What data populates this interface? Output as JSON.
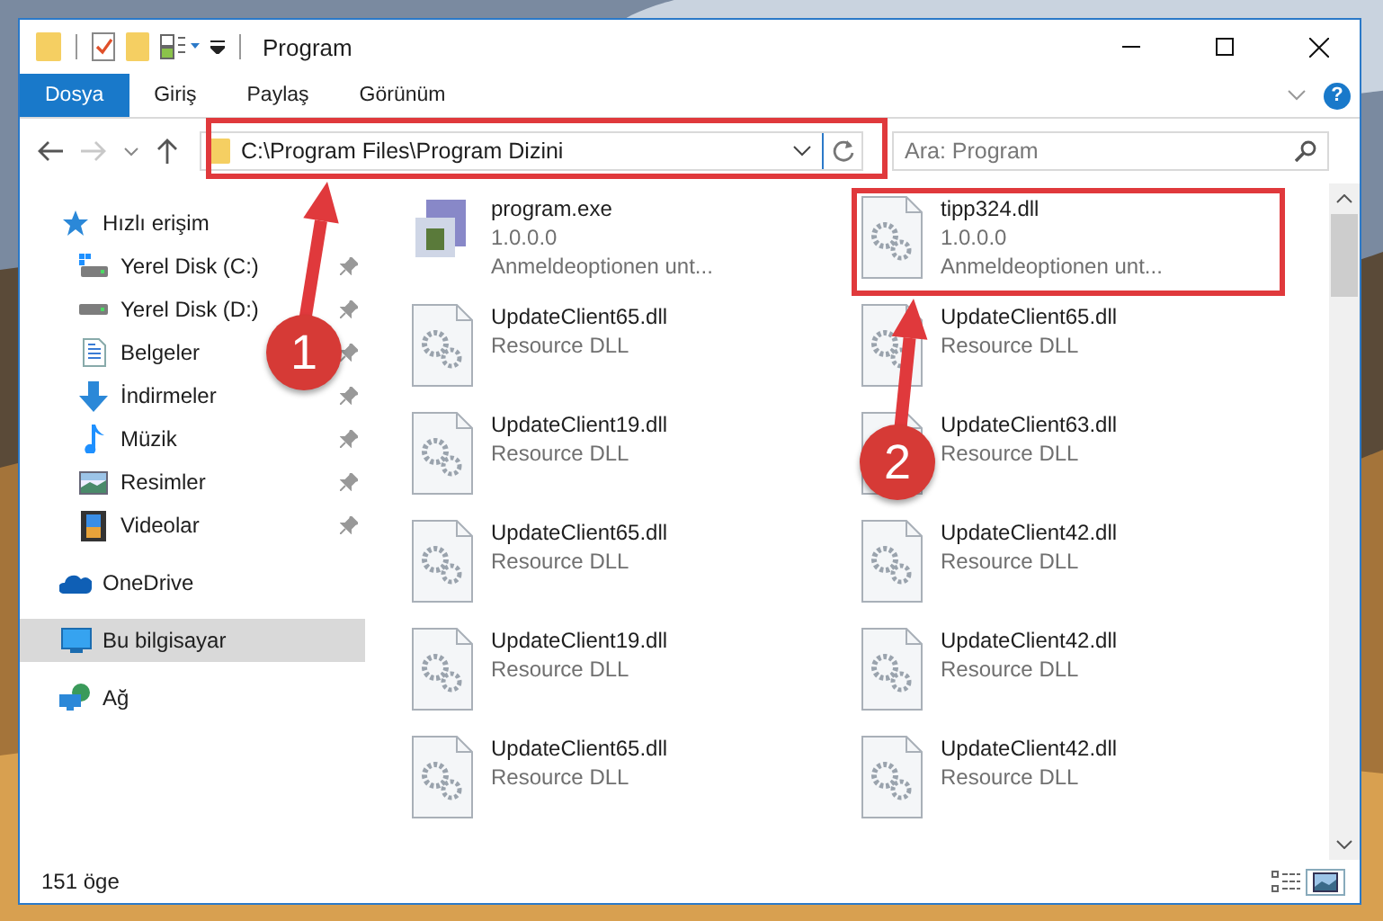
{
  "window": {
    "title": "Program"
  },
  "ribbon": {
    "tabs": [
      {
        "label": "Dosya",
        "selected": true
      },
      {
        "label": "Giriş",
        "selected": false
      },
      {
        "label": "Paylaş",
        "selected": false
      },
      {
        "label": "Görünüm",
        "selected": false
      }
    ],
    "help": "?"
  },
  "address": {
    "path": "C:\\Program Files\\Program Dizini",
    "search_placeholder": "Ara: Program"
  },
  "sidebar": {
    "items": [
      {
        "label": "Hızlı erişim",
        "kind": "star",
        "selected": false,
        "children": [
          {
            "label": "Yerel Disk (C:)",
            "kind": "system-drive",
            "selected": false,
            "pinned": true
          },
          {
            "label": "Yerel Disk (D:)",
            "kind": "drive",
            "selected": false,
            "pinned": true
          },
          {
            "label": "Belgeler",
            "kind": "documents",
            "selected": false,
            "pinned": true
          },
          {
            "label": "İndirmeler",
            "kind": "download",
            "selected": false,
            "pinned": true
          },
          {
            "label": "Müzik",
            "kind": "music",
            "selected": false,
            "pinned": true
          },
          {
            "label": "Resimler",
            "kind": "pictures",
            "selected": false,
            "pinned": true
          },
          {
            "label": "Videolar",
            "kind": "videos",
            "selected": false,
            "pinned": true
          }
        ]
      },
      {
        "label": "OneDrive",
        "kind": "cloud",
        "selected": false
      },
      {
        "label": "Bu bilgisayar",
        "kind": "computer",
        "selected": true
      },
      {
        "label": "Ağ",
        "kind": "network",
        "selected": false
      }
    ]
  },
  "files": [
    {
      "name": "program.exe",
      "lines": [
        "1.0.0.0",
        "Anmeldeoptionen unt..."
      ],
      "kind": "exe"
    },
    {
      "name": "tipp324.dll",
      "lines": [
        "1.0.0.0",
        "Anmeldeoptionen unt..."
      ],
      "kind": "dll"
    },
    {
      "name": "UpdateClient65.dll",
      "lines": [
        "Resource DLL"
      ],
      "kind": "dll"
    },
    {
      "name": "UpdateClient65.dll",
      "lines": [
        "Resource DLL"
      ],
      "kind": "dll"
    },
    {
      "name": "UpdateClient19.dll",
      "lines": [
        "Resource DLL"
      ],
      "kind": "dll"
    },
    {
      "name": "UpdateClient63.dll",
      "lines": [
        "Resource DLL"
      ],
      "kind": "dll"
    },
    {
      "name": "UpdateClient65.dll",
      "lines": [
        "Resource DLL"
      ],
      "kind": "dll"
    },
    {
      "name": "UpdateClient42.dll",
      "lines": [
        "Resource DLL"
      ],
      "kind": "dll"
    },
    {
      "name": "UpdateClient19.dll",
      "lines": [
        "Resource DLL"
      ],
      "kind": "dll"
    },
    {
      "name": "UpdateClient42.dll",
      "lines": [
        "Resource DLL"
      ],
      "kind": "dll"
    },
    {
      "name": "UpdateClient65.dll",
      "lines": [
        "Resource DLL"
      ],
      "kind": "dll"
    },
    {
      "name": "UpdateClient42.dll",
      "lines": [
        "Resource DLL"
      ],
      "kind": "dll"
    }
  ],
  "status_bar": {
    "count": "151 öge"
  },
  "callouts": [
    {
      "number": "1"
    },
    {
      "number": "2"
    }
  ]
}
